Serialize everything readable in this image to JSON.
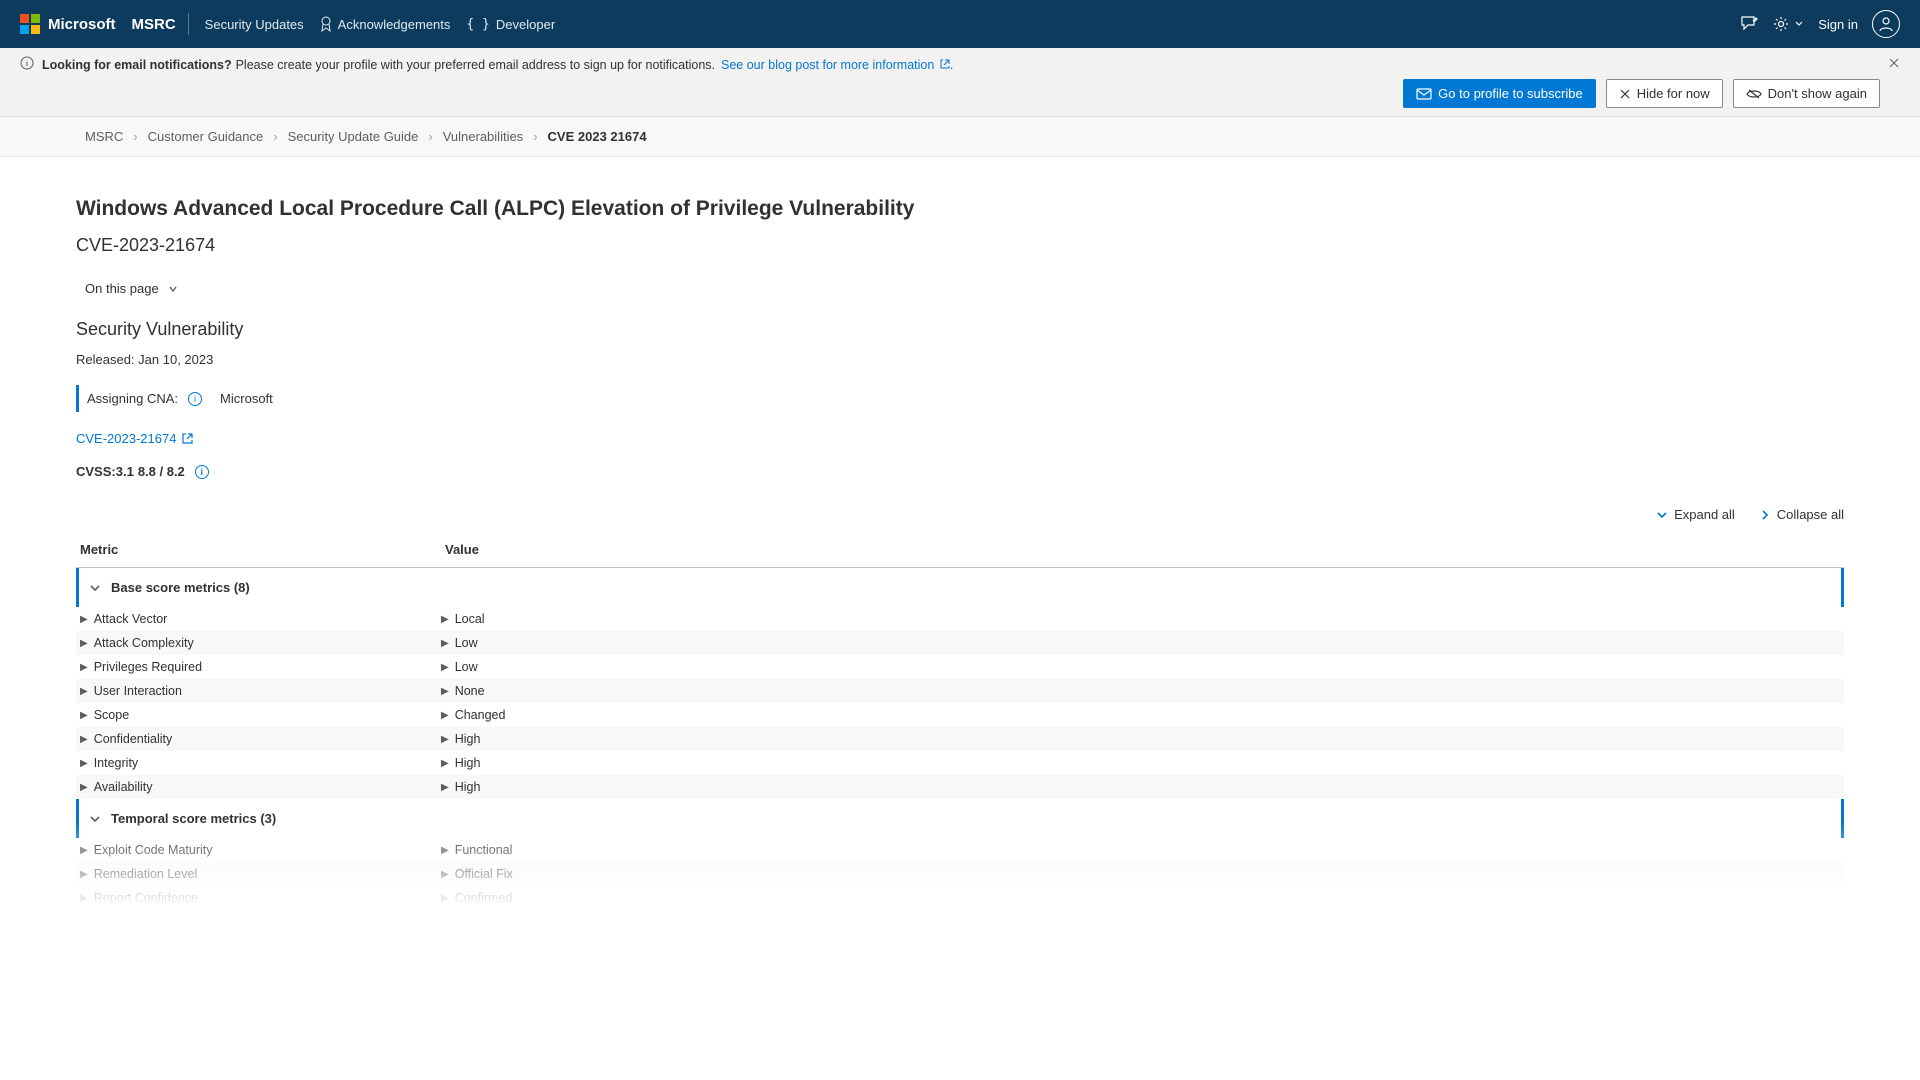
{
  "header": {
    "logo_text": "Microsoft",
    "nav": [
      {
        "label": "MSRC",
        "active": true
      },
      {
        "label": "Security Updates"
      },
      {
        "label": "Acknowledgements",
        "icon": "ribbon"
      },
      {
        "label": "Developer",
        "icon": "braces"
      }
    ],
    "sign_in": "Sign in"
  },
  "info_bar": {
    "bold": "Looking for email notifications?",
    "text": "Please create your profile with your preferred email address to sign up for notifications.",
    "link": "See our blog post for more information",
    "actions": {
      "subscribe": "Go to profile to subscribe",
      "hide": "Hide for now",
      "dont_show": "Don't show again"
    }
  },
  "breadcrumb": [
    "MSRC",
    "Customer Guidance",
    "Security Update Guide",
    "Vulnerabilities",
    "CVE 2023 21674"
  ],
  "page": {
    "title": "Windows Advanced Local Procedure Call (ALPC) Elevation of Privilege Vulnerability",
    "cve": "CVE-2023-21674",
    "on_this_page": "On this page",
    "section": "Security Vulnerability",
    "released_label": "Released:",
    "released_date": "Jan 10, 2023",
    "assigning_label": "Assigning CNA:",
    "assigning_value": "Microsoft",
    "cve_link": "CVE-2023-21674",
    "cvss_label": "CVSS:3.1",
    "cvss_score": "8.8 / 8.2",
    "expand_all": "Expand all",
    "collapse_all": "Collapse all",
    "col_metric": "Metric",
    "col_value": "Value",
    "group1": "Base score metrics (8)",
    "group2": "Temporal score metrics (3)",
    "base_metrics": [
      {
        "name": "Attack Vector",
        "value": "Local"
      },
      {
        "name": "Attack Complexity",
        "value": "Low"
      },
      {
        "name": "Privileges Required",
        "value": "Low"
      },
      {
        "name": "User Interaction",
        "value": "None"
      },
      {
        "name": "Scope",
        "value": "Changed"
      },
      {
        "name": "Confidentiality",
        "value": "High"
      },
      {
        "name": "Integrity",
        "value": "High"
      },
      {
        "name": "Availability",
        "value": "High"
      }
    ],
    "temporal_metrics": [
      {
        "name": "Exploit Code Maturity",
        "value": "Functional"
      },
      {
        "name": "Remediation Level",
        "value": "Official Fix"
      },
      {
        "name": "Report Confidence",
        "value": "Confirmed"
      }
    ]
  }
}
